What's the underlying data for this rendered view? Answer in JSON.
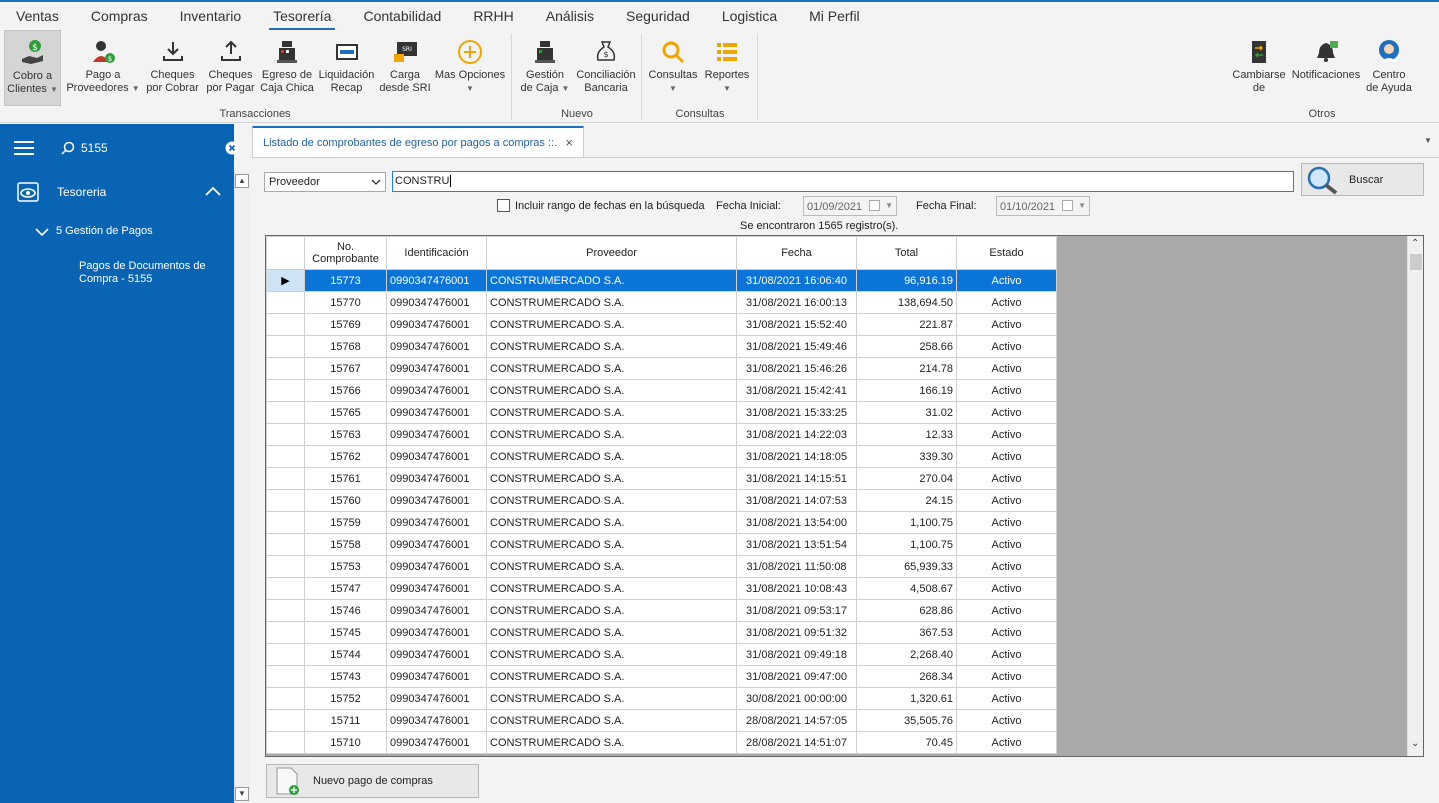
{
  "menu": {
    "tabs": [
      "Ventas",
      "Compras",
      "Inventario",
      "Tesorería",
      "Contabilidad",
      "RRHH",
      "Análisis",
      "Seguridad",
      "Logistica",
      "Mi Perfil"
    ]
  },
  "ribbon": {
    "cobro_line1": "Cobro a",
    "cobro_line2": "Clientes",
    "pago_line1": "Pago a",
    "pago_line2": "Proveedores",
    "cheques_cobrar_line1": "Cheques",
    "cheques_cobrar_line2": "por Cobrar",
    "cheques_pagar_line1": "Cheques",
    "cheques_pagar_line2": "por Pagar",
    "egreso_line1": "Egreso de",
    "egreso_line2": "Caja Chica",
    "liquidacion_line1": "Liquidación",
    "liquidacion_line2": "Recap",
    "carga_line1": "Carga",
    "carga_line2": "desde SRI",
    "mas_opciones": "Mas Opciones",
    "gestion_line1": "Gestión",
    "gestion_line2": "de Caja",
    "conciliacion_line1": "Conciliación",
    "conciliacion_line2": "Bancaria",
    "consultas": "Consultas",
    "reportes": "Reportes",
    "cambiarse_line1": "Cambiarse",
    "cambiarse_line2": "de",
    "notificaciones": "Notificaciones",
    "centro_line1": "Centro",
    "centro_line2": "de Ayuda",
    "group_transacciones": "Transacciones",
    "group_nuevo": "Nuevo",
    "group_consultas": "Consultas",
    "group_otros": "Otros"
  },
  "sidebar": {
    "search_value": "5155",
    "module": "Tesoreria",
    "section": "5 Gestión de Pagos",
    "item_line1": "Pagos de Documentos de",
    "item_line2": "Compra - 5155"
  },
  "doc_tab": {
    "title": "Listado de comprobantes de egreso por pagos a compras ::."
  },
  "search": {
    "field": "Proveedor",
    "value": "CONSTRU",
    "button": "Buscar",
    "date_range_label": "Incluir rango de fechas en la búsqueda",
    "fecha_inicial_label": "Fecha Inicial:",
    "fecha_inicial": "01/09/2021",
    "fecha_final_label": "Fecha Final:",
    "fecha_final": "01/10/2021",
    "found": "Se encontraron 1565 registro(s)."
  },
  "table": {
    "h_no_line1": "No.",
    "h_no_line2": "Comprobante",
    "h_id": "Identificación",
    "h_prov": "Proveedor",
    "h_fecha": "Fecha",
    "h_total": "Total",
    "h_estado": "Estado",
    "rows": [
      [
        "15773",
        "0990347476001",
        "CONSTRUMERCADO S.A.",
        "31/08/2021 16:06:40",
        "96,916.19",
        "Activo"
      ],
      [
        "15770",
        "0990347476001",
        "CONSTRUMERCADO S.A.",
        "31/08/2021 16:00:13",
        "138,694.50",
        "Activo"
      ],
      [
        "15769",
        "0990347476001",
        "CONSTRUMERCADO S.A.",
        "31/08/2021 15:52:40",
        "221.87",
        "Activo"
      ],
      [
        "15768",
        "0990347476001",
        "CONSTRUMERCADO S.A.",
        "31/08/2021 15:49:46",
        "258.66",
        "Activo"
      ],
      [
        "15767",
        "0990347476001",
        "CONSTRUMERCADO S.A.",
        "31/08/2021 15:46:26",
        "214.78",
        "Activo"
      ],
      [
        "15766",
        "0990347476001",
        "CONSTRUMERCADO S.A.",
        "31/08/2021 15:42:41",
        "166.19",
        "Activo"
      ],
      [
        "15765",
        "0990347476001",
        "CONSTRUMERCADO S.A.",
        "31/08/2021 15:33:25",
        "31.02",
        "Activo"
      ],
      [
        "15763",
        "0990347476001",
        "CONSTRUMERCADO S.A.",
        "31/08/2021 14:22:03",
        "12.33",
        "Activo"
      ],
      [
        "15762",
        "0990347476001",
        "CONSTRUMERCADO S.A.",
        "31/08/2021 14:18:05",
        "339.30",
        "Activo"
      ],
      [
        "15761",
        "0990347476001",
        "CONSTRUMERCADO S.A.",
        "31/08/2021 14:15:51",
        "270.04",
        "Activo"
      ],
      [
        "15760",
        "0990347476001",
        "CONSTRUMERCADO S.A.",
        "31/08/2021 14:07:53",
        "24.15",
        "Activo"
      ],
      [
        "15759",
        "0990347476001",
        "CONSTRUMERCADO S.A.",
        "31/08/2021 13:54:00",
        "1,100.75",
        "Activo"
      ],
      [
        "15758",
        "0990347476001",
        "CONSTRUMERCADO S.A.",
        "31/08/2021 13:51:54",
        "1,100.75",
        "Activo"
      ],
      [
        "15753",
        "0990347476001",
        "CONSTRUMERCADO S.A.",
        "31/08/2021 11:50:08",
        "65,939.33",
        "Activo"
      ],
      [
        "15747",
        "0990347476001",
        "CONSTRUMERCADO S.A.",
        "31/08/2021 10:08:43",
        "4,508.67",
        "Activo"
      ],
      [
        "15746",
        "0990347476001",
        "CONSTRUMERCADO S.A.",
        "31/08/2021 09:53:17",
        "628.86",
        "Activo"
      ],
      [
        "15745",
        "0990347476001",
        "CONSTRUMERCADO S.A.",
        "31/08/2021 09:51:32",
        "367.53",
        "Activo"
      ],
      [
        "15744",
        "0990347476001",
        "CONSTRUMERCADO S.A.",
        "31/08/2021 09:49:18",
        "2,268.40",
        "Activo"
      ],
      [
        "15743",
        "0990347476001",
        "CONSTRUMERCADO S.A.",
        "31/08/2021 09:47:00",
        "268.34",
        "Activo"
      ],
      [
        "15752",
        "0990347476001",
        "CONSTRUMERCADO S.A.",
        "30/08/2021 00:00:00",
        "1,320.61",
        "Activo"
      ],
      [
        "15711",
        "0990347476001",
        "CONSTRUMERCADO S.A.",
        "28/08/2021 14:57:05",
        "35,505.76",
        "Activo"
      ],
      [
        "15710",
        "0990347476001",
        "CONSTRUMERCADO S.A.",
        "28/08/2021 14:51:07",
        "70.45",
        "Activo"
      ]
    ]
  },
  "nuevo_button": "Nuevo pago de compras",
  "colors": {
    "accent": "#1f6fc0",
    "sidebar": "#0a64b4",
    "selection": "#0a74d8"
  }
}
